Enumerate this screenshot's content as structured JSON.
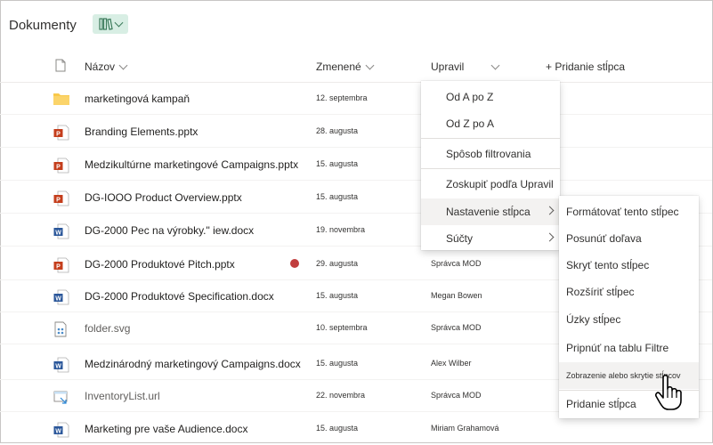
{
  "library": {
    "title": "Dokumenty"
  },
  "columns": {
    "name": "Názov",
    "modified": "Zmenené",
    "modified_by": "Upravil",
    "add_column": "+ Pridanie stĺpca"
  },
  "files": [
    {
      "name": "marketingová kampaň",
      "date": "12. septembra",
      "by": "",
      "icon": "folder-icon"
    },
    {
      "name": "Branding Elements.pptx",
      "date": "28. augusta",
      "by": "",
      "icon": "powerpoint-icon"
    },
    {
      "name": "Medzikultúrne marketingové Campaigns.pptx",
      "date": "15. augusta",
      "by": "",
      "icon": "powerpoint-icon"
    },
    {
      "name": "DG-IOOO Product Overview.pptx",
      "date": "15. augusta",
      "by": "",
      "icon": "powerpoint-icon"
    },
    {
      "name": "DG-2000 Pec na výrobky.\" iew.docx",
      "date": "19. novembra",
      "by": "",
      "icon": "word-icon"
    },
    {
      "name": "DG-2000 Produktové Pitch.pptx",
      "date": "29. augusta",
      "by": "Správca MOD",
      "icon": "powerpoint-icon"
    },
    {
      "name": "DG-2000 Produktové Specification.docx",
      "date": "15. augusta",
      "by": "Megan Bowen",
      "icon": "word-icon"
    },
    {
      "name": "folder.svg",
      "date": "10. septembra",
      "by": "Správca MOD",
      "icon": "svg-file-icon"
    },
    {
      "name": "Medzinárodný marketingový Campaigns.docx",
      "date": "15. augusta",
      "by": "Alex Wilber",
      "icon": "word-icon"
    },
    {
      "name": "InventoryList.url",
      "date": "22. novembra",
      "by": "Správca MOD",
      "icon": "url-file-icon"
    },
    {
      "name": "Marketing pre vaše Audience.docx",
      "date": "15. augusta",
      "by": "Miriam Grahamová",
      "icon": "word-icon"
    }
  ],
  "column_menu": {
    "sort_az": "Od A po Z",
    "sort_za": "Od Z po A",
    "filter_by": "Spôsob filtrovania",
    "group_by": "Zoskupiť podľa Upravil",
    "column_settings": "Nastavenie stĺpca",
    "totals": "Súčty"
  },
  "submenu": {
    "format_column": "Formátovať tento stĺpec",
    "move_left": "Posunúť doľava",
    "hide_column": "Skryť tento stĺpec",
    "widen_column": "Rozšíriť stĺpec",
    "narrow_column": "Úzky stĺpec",
    "pin_to_filters": "Pripnúť na tablu Filtre",
    "show_hide_columns": "Zobrazenie alebo skrytie stĺpcov",
    "add_column": "Pridanie stĺpca"
  },
  "colors": {
    "powerpoint": "#c43e1c",
    "word": "#2b579a",
    "folder": "#f8c84a",
    "view_button": "#d8eee4",
    "hover": "#f3f2f1",
    "error_badge": "#c13e3e"
  }
}
